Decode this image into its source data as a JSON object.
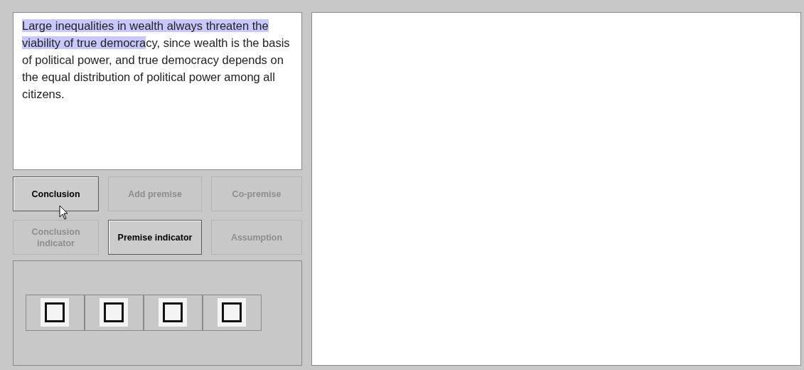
{
  "passage": {
    "highlighted": "Large inequalities in wealth always threaten the viability of true democra",
    "rest": "cy, since wealth is the basis of political power, and true democracy depends on the equal distribution of political power among all citizens."
  },
  "buttons": [
    {
      "label": "Conclusion",
      "disabled": false
    },
    {
      "label": "Add premise",
      "disabled": true
    },
    {
      "label": "Co-premise",
      "disabled": true
    },
    {
      "label": "Conclusion indicator",
      "disabled": true
    },
    {
      "label": "Premise indicator",
      "disabled": false
    },
    {
      "label": "Assumption",
      "disabled": true
    }
  ],
  "slots": [
    {
      "checked": false
    },
    {
      "checked": false
    },
    {
      "checked": false
    },
    {
      "checked": false
    }
  ]
}
